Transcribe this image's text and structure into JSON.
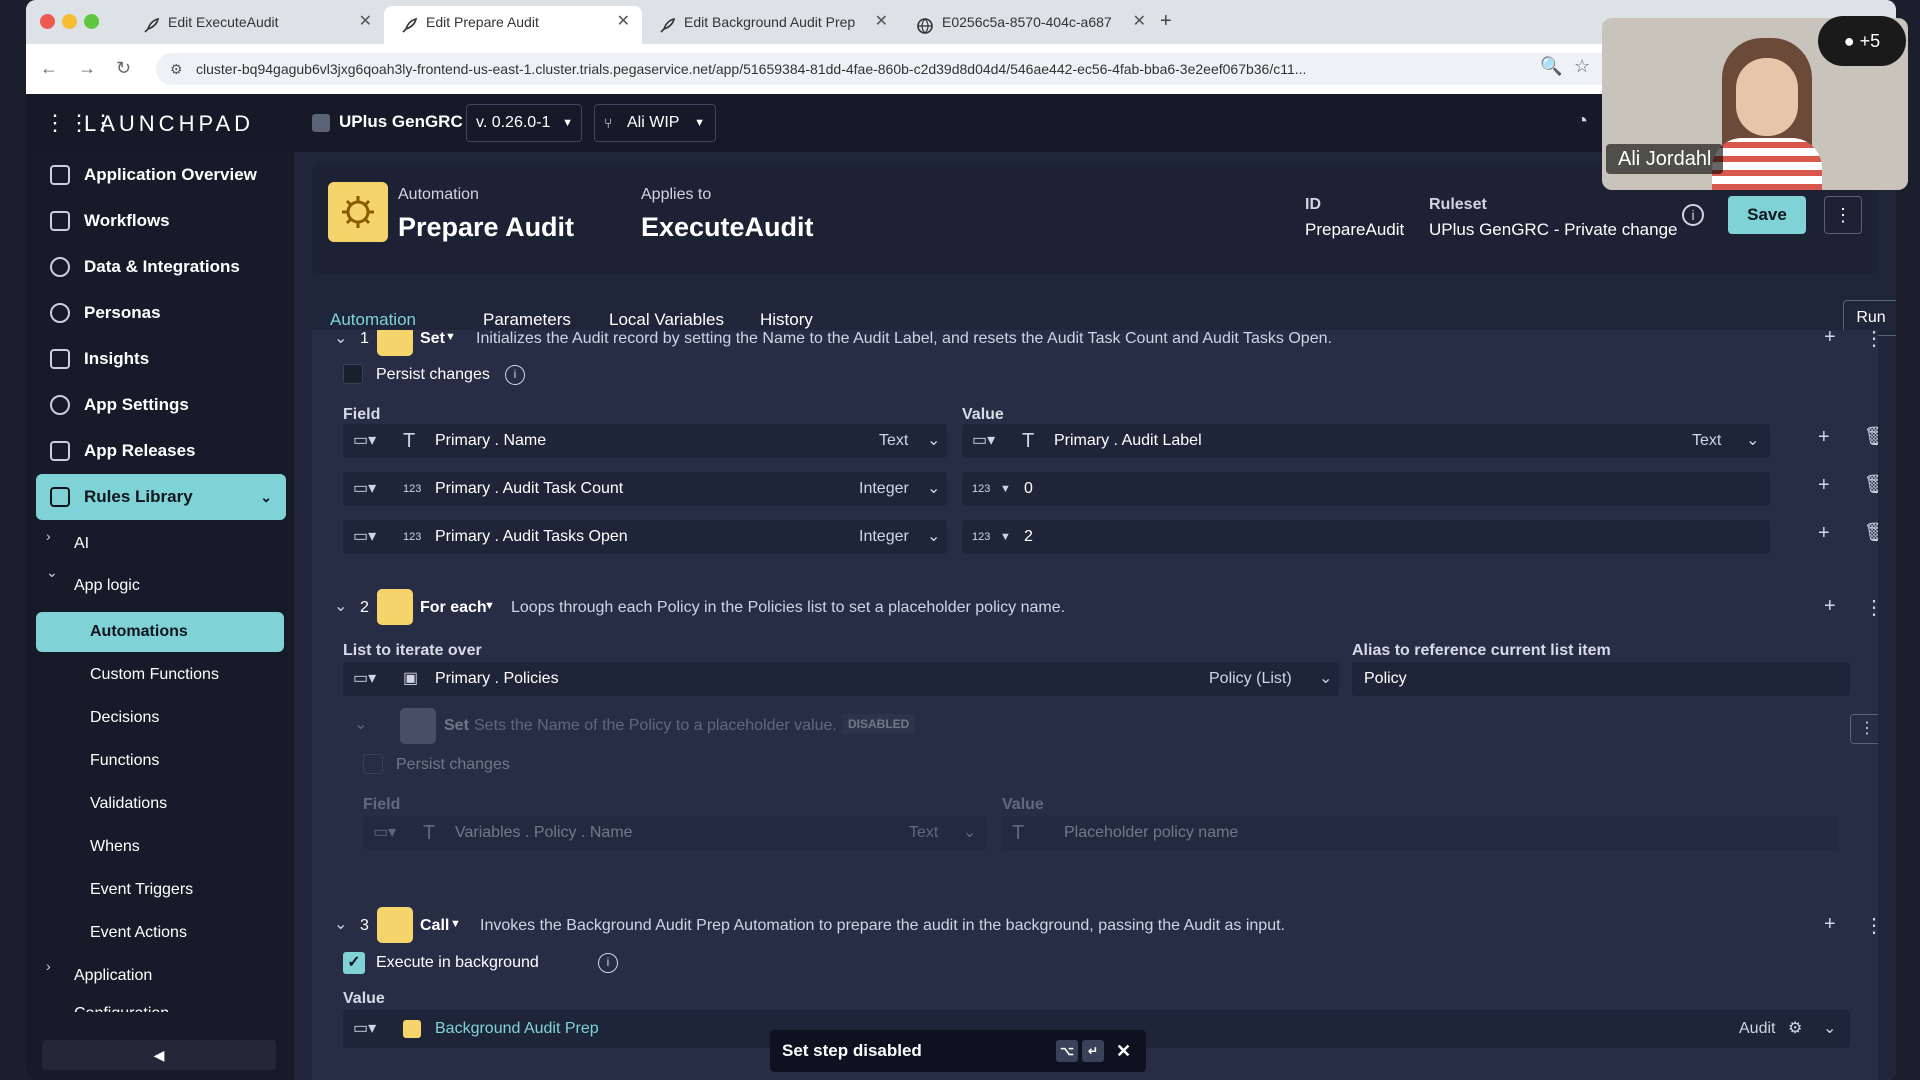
{
  "browser": {
    "tabs": [
      {
        "label": "Edit ExecuteAudit"
      },
      {
        "label": "Edit Prepare Audit"
      },
      {
        "label": "Edit Background Audit Prep"
      },
      {
        "label": "E0256c5a-8570-404c-a687"
      }
    ],
    "url": "cluster-bq94gagub6vl3jxg6qoah3ly-frontend-us-east-1.cluster.trials.pegaservice.net/app/51659384-81dd-4fae-860b-c2d39d8d04d4/546ae442-ec56-4fab-bba6-3e2eef067b36/c11..."
  },
  "topbar": {
    "brand": "LAUNCHPAD",
    "app_name": "UPlus GenGRC",
    "version": "v. 0.26.0-1",
    "branch": "Ali WIP"
  },
  "sidebar": {
    "items": [
      {
        "label": "Application Overview"
      },
      {
        "label": "Workflows"
      },
      {
        "label": "Data & Integrations"
      },
      {
        "label": "Personas"
      },
      {
        "label": "Insights"
      },
      {
        "label": "App Settings"
      },
      {
        "label": "App Releases"
      },
      {
        "label": "Rules Library"
      }
    ],
    "tree": {
      "ai": "AI",
      "app_logic": "App logic",
      "automations": "Automations",
      "custom_functions": "Custom Functions",
      "decisions": "Decisions",
      "functions": "Functions",
      "validations": "Validations",
      "whens": "Whens",
      "event_triggers": "Event Triggers",
      "event_actions": "Event Actions",
      "application": "Application",
      "configuration": "Configuration"
    }
  },
  "header": {
    "type_label": "Automation",
    "name": "Prepare Audit",
    "applies_label": "Applies to",
    "applies_value": "ExecuteAudit",
    "id_label": "ID",
    "id_value": "PrepareAudit",
    "ruleset_label": "Ruleset",
    "ruleset_value": "UPlus GenGRC - Private change",
    "save_label": "Save",
    "run_label": "Run"
  },
  "page_tabs": [
    "Automation",
    "Parameters",
    "Local Variables",
    "History"
  ],
  "steps": {
    "s1": {
      "num": "1",
      "action": "Set",
      "description": "Initializes the Audit record by setting the Name to the Audit Label, and resets the Audit Task Count and Audit Tasks Open.",
      "persist": "Persist changes",
      "field_label": "Field",
      "value_label": "Value",
      "rows": [
        {
          "field": "Primary . Name",
          "ftype": "Text",
          "value": "Primary . Audit Label",
          "vtype": "Text"
        },
        {
          "field": "Primary . Audit Task Count",
          "ftype": "Integer",
          "value": "0"
        },
        {
          "field": "Primary . Audit Tasks Open",
          "ftype": "Integer",
          "value": "2"
        }
      ]
    },
    "s2": {
      "num": "2",
      "action": "For each",
      "description": "Loops through each Policy in the Policies list to set a placeholder policy name.",
      "list_label": "List to iterate over",
      "list_value": "Primary . Policies",
      "list_type": "Policy (List)",
      "alias_label": "Alias to reference current list item",
      "alias_value": "Policy",
      "inner": {
        "action": "Set",
        "description": "Sets the Name of the Policy to a placeholder value.",
        "badge": "DISABLED",
        "persist": "Persist changes",
        "field_label": "Field",
        "value_label": "Value",
        "field": "Variables . Policy . Name",
        "ftype": "Text",
        "value": "Placeholder policy name"
      }
    },
    "s3": {
      "num": "3",
      "action": "Call",
      "description": "Invokes the Background Audit Prep Automation to prepare the audit in the background, passing the Audit as input.",
      "exec_bg": "Execute in background",
      "value_label": "Value",
      "value": "Background Audit Prep",
      "input": "Audit"
    }
  },
  "toast": {
    "message": "Set step disabled"
  },
  "video": {
    "name": "Ali Jordahl",
    "count": "+5"
  },
  "num_icon": "123",
  "colors": {
    "accent": "#7fd3d6",
    "bg": "#20263a",
    "step_icon": "#f5d46c"
  }
}
